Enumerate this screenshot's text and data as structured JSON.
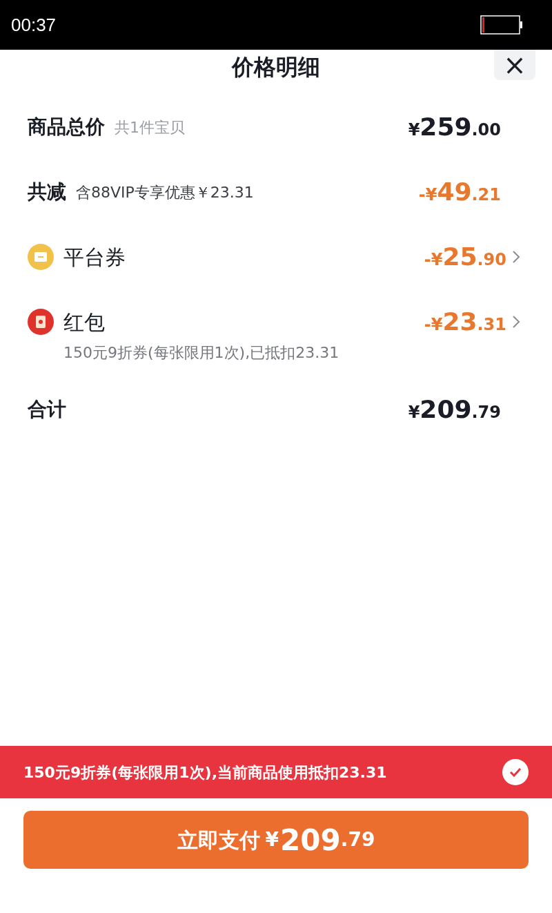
{
  "status_bar": {
    "time": "00:37"
  },
  "sheet": {
    "title": "价格明细",
    "close": "×"
  },
  "rows": [
    {
      "kind": "total",
      "label": "商品总价",
      "note": "共1件宝贝",
      "amount": {
        "currency": "¥",
        "integer": "259",
        "decimal": ".00"
      },
      "discount": false
    },
    {
      "kind": "total",
      "label": "共减",
      "note": "含88VIP专享优惠￥23.31",
      "amount": {
        "currency": "-¥",
        "integer": "49",
        "decimal": ".21"
      },
      "discount": true
    },
    {
      "kind": "coupon",
      "label": "平台券",
      "amount": {
        "currency": "-¥",
        "integer": "25",
        "decimal": ".90"
      },
      "discount": true
    },
    {
      "kind": "redpacket",
      "label": "红包",
      "sub": "150元9折券(每张限用1次),已抵扣23.31",
      "amount": {
        "currency": "-¥",
        "integer": "23",
        "decimal": ".31"
      },
      "discount": true
    },
    {
      "kind": "total",
      "label": "合计",
      "amount": {
        "currency": "¥",
        "integer": "209",
        "decimal": ".79"
      },
      "discount": false
    }
  ],
  "banner": {
    "text": "150元9折券(每张限用1次),当前商品使用抵扣23.31",
    "checked": true
  },
  "pay_button": {
    "label": "立即支付",
    "currency": "¥",
    "integer": "209",
    "decimal": ".79"
  }
}
